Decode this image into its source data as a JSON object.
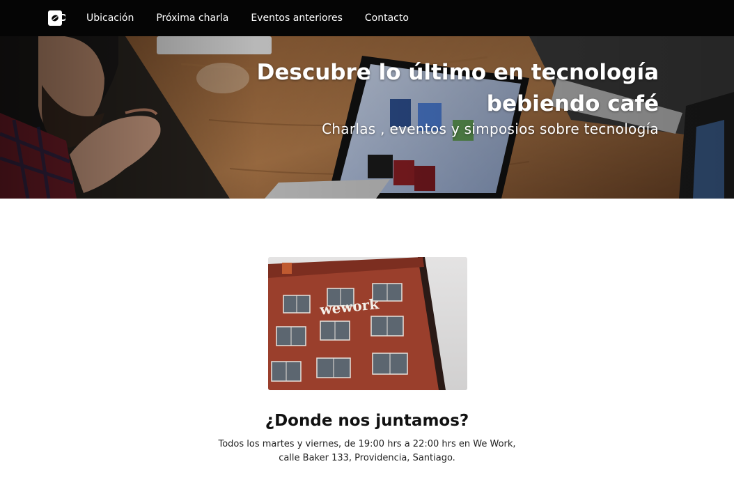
{
  "navbar": {
    "logo_icon": "coffee-cup-icon",
    "links": [
      {
        "label": "Ubicación"
      },
      {
        "label": "Próxima charla"
      },
      {
        "label": "Eventos anteriores"
      },
      {
        "label": "Contacto"
      }
    ],
    "background_color": "#050505",
    "text_color": "#ffffff"
  },
  "hero": {
    "title_line1": "Descubre lo último en tecnología",
    "title_line2": "bebiendo café",
    "subtitle": "Charlas , eventos y simposios sobre tecnología"
  },
  "location": {
    "photo_sign": "wework",
    "title": "¿Donde nos juntamos?",
    "text_line1": "Todos los martes y viernes, de 19:00 hrs a 22:00 hrs en We Work,",
    "text_line2": "calle Baker 133, Providencia, Santiago."
  }
}
